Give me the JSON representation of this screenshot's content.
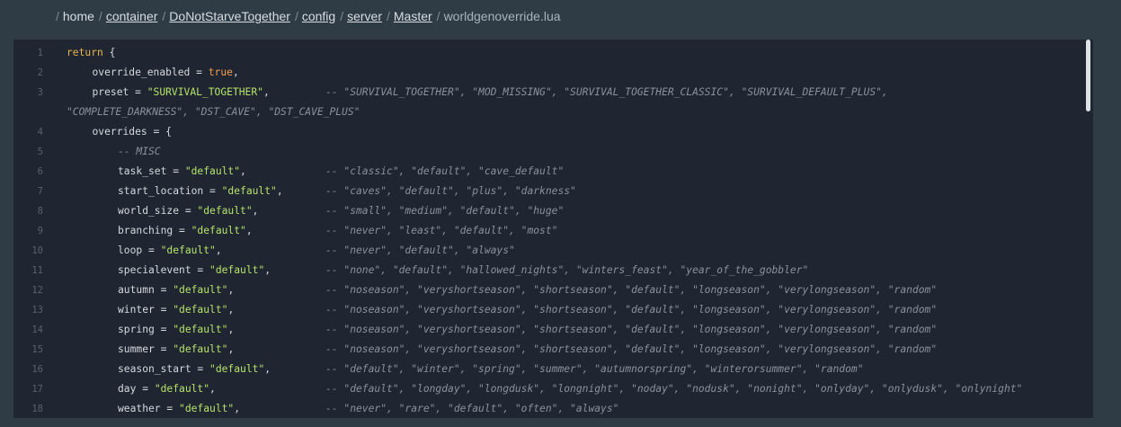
{
  "breadcrumb": [
    {
      "label": "home",
      "link": false
    },
    {
      "label": "container",
      "link": true
    },
    {
      "label": "DoNotStarveTogether",
      "link": true
    },
    {
      "label": "config",
      "link": true
    },
    {
      "label": "server",
      "link": true
    },
    {
      "label": "Master",
      "link": true
    },
    {
      "label": "worldgenoverride.lua",
      "link": false
    }
  ],
  "separator": "/",
  "lines": [
    {
      "n": "1",
      "indent": 0,
      "tokens": [
        [
          "kw",
          "return"
        ],
        [
          "p",
          " {"
        ]
      ]
    },
    {
      "n": "2",
      "indent": 1,
      "tokens": [
        [
          "p",
          "override_enabled = "
        ],
        [
          "bool",
          "true"
        ],
        [
          "p",
          ","
        ]
      ]
    },
    {
      "n": "3",
      "indent": 1,
      "tokens": [
        [
          "p",
          "preset = "
        ],
        [
          "str",
          "\"SURVIVAL_TOGETHER\""
        ],
        [
          "p",
          ","
        ]
      ],
      "comment": "-- \"SURVIVAL_TOGETHER\", \"MOD_MISSING\", \"SURVIVAL_TOGETHER_CLASSIC\", \"SURVIVAL_DEFAULT_PLUS\",",
      "comment_col": 317,
      "wrap": "\"COMPLETE_DARKNESS\", \"DST_CAVE\", \"DST_CAVE_PLUS\""
    },
    {
      "n": "4",
      "indent": 1,
      "tokens": [
        [
          "p",
          "overrides = {"
        ]
      ]
    },
    {
      "n": "5",
      "indent": 2,
      "tokens": [
        [
          "cm",
          "-- MISC"
        ]
      ]
    },
    {
      "n": "6",
      "indent": 2,
      "tokens": [
        [
          "p",
          "task_set = "
        ],
        [
          "str",
          "\"default\""
        ],
        [
          "p",
          ","
        ]
      ],
      "comment": "-- \"classic\", \"default\", \"cave_default\""
    },
    {
      "n": "7",
      "indent": 2,
      "tokens": [
        [
          "p",
          "start_location = "
        ],
        [
          "str",
          "\"default\""
        ],
        [
          "p",
          ","
        ]
      ],
      "comment": "-- \"caves\", \"default\", \"plus\", \"darkness\""
    },
    {
      "n": "8",
      "indent": 2,
      "tokens": [
        [
          "p",
          "world_size = "
        ],
        [
          "str",
          "\"default\""
        ],
        [
          "p",
          ","
        ]
      ],
      "comment": "-- \"small\", \"medium\", \"default\", \"huge\""
    },
    {
      "n": "9",
      "indent": 2,
      "tokens": [
        [
          "p",
          "branching = "
        ],
        [
          "str",
          "\"default\""
        ],
        [
          "p",
          ","
        ]
      ],
      "comment": "-- \"never\", \"least\", \"default\", \"most\""
    },
    {
      "n": "10",
      "indent": 2,
      "tokens": [
        [
          "p",
          "loop = "
        ],
        [
          "str",
          "\"default\""
        ],
        [
          "p",
          ","
        ]
      ],
      "comment": "-- \"never\", \"default\", \"always\""
    },
    {
      "n": "11",
      "indent": 2,
      "tokens": [
        [
          "p",
          "specialevent = "
        ],
        [
          "str",
          "\"default\""
        ],
        [
          "p",
          ","
        ]
      ],
      "comment": "-- \"none\", \"default\", \"hallowed_nights\", \"winters_feast\", \"year_of_the_gobbler\""
    },
    {
      "n": "12",
      "indent": 2,
      "tokens": [
        [
          "p",
          "autumn = "
        ],
        [
          "str",
          "\"default\""
        ],
        [
          "p",
          ","
        ]
      ],
      "comment": "-- \"noseason\", \"veryshortseason\", \"shortseason\", \"default\", \"longseason\", \"verylongseason\", \"random\""
    },
    {
      "n": "13",
      "indent": 2,
      "tokens": [
        [
          "p",
          "winter = "
        ],
        [
          "str",
          "\"default\""
        ],
        [
          "p",
          ","
        ]
      ],
      "comment": "-- \"noseason\", \"veryshortseason\", \"shortseason\", \"default\", \"longseason\", \"verylongseason\", \"random\""
    },
    {
      "n": "14",
      "indent": 2,
      "tokens": [
        [
          "p",
          "spring = "
        ],
        [
          "str",
          "\"default\""
        ],
        [
          "p",
          ","
        ]
      ],
      "comment": "-- \"noseason\", \"veryshortseason\", \"shortseason\", \"default\", \"longseason\", \"verylongseason\", \"random\""
    },
    {
      "n": "15",
      "indent": 2,
      "tokens": [
        [
          "p",
          "summer = "
        ],
        [
          "str",
          "\"default\""
        ],
        [
          "p",
          ","
        ]
      ],
      "comment": "-- \"noseason\", \"veryshortseason\", \"shortseason\", \"default\", \"longseason\", \"verylongseason\", \"random\""
    },
    {
      "n": "16",
      "indent": 2,
      "tokens": [
        [
          "p",
          "season_start = "
        ],
        [
          "str",
          "\"default\""
        ],
        [
          "p",
          ","
        ]
      ],
      "comment": "-- \"default\", \"winter\", \"spring\", \"summer\", \"autumnorspring\", \"winterorsummer\", \"random\""
    },
    {
      "n": "17",
      "indent": 2,
      "tokens": [
        [
          "p",
          "day = "
        ],
        [
          "str",
          "\"default\""
        ],
        [
          "p",
          ","
        ]
      ],
      "comment": "-- \"default\", \"longday\", \"longdusk\", \"longnight\", \"noday\", \"nodusk\", \"nonight\", \"onlyday\", \"onlydusk\", \"onlynight\""
    },
    {
      "n": "18",
      "indent": 2,
      "tokens": [
        [
          "p",
          "weather = "
        ],
        [
          "str",
          "\"default\""
        ],
        [
          "p",
          ","
        ]
      ],
      "comment": "-- \"never\", \"rare\", \"default\", \"often\", \"always\""
    }
  ]
}
